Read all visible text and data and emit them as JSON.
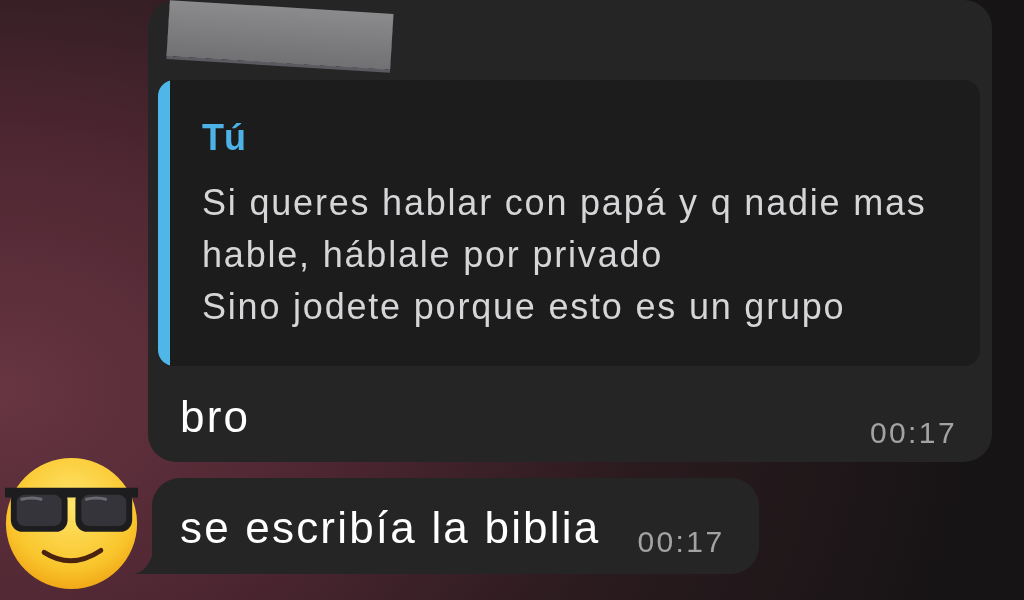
{
  "messages": [
    {
      "kind": "reply",
      "sender_redacted": true,
      "avatar": false,
      "reply_to": {
        "author": "Tú",
        "text": "Si queres hablar con papá y q nadie mas hable, háblale por privado\nSino jodete porque esto es un grupo"
      },
      "text": "bro",
      "time": "00:17"
    },
    {
      "kind": "plain",
      "sender_redacted": false,
      "avatar": true,
      "text": "se escribía la biblia",
      "time": "00:17"
    }
  ]
}
